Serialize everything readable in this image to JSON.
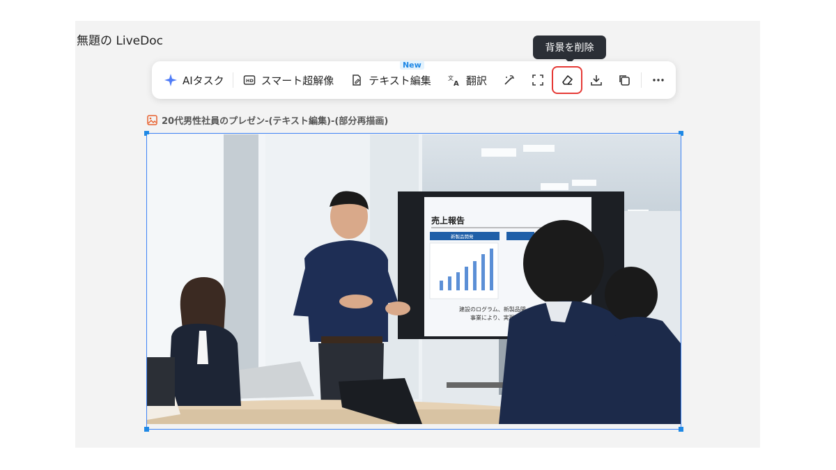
{
  "doc_title": "無題の LiveDoc",
  "tooltip": "背景を削除",
  "toolbar": {
    "ai_task": "AIタスク",
    "smart_upscale": "スマート超解像",
    "text_edit": "テキスト編集",
    "new_badge": "New",
    "translate": "翻訳"
  },
  "image_label": "20代男性社員のプレゼン-(テキスト編集)-(部分再描画)",
  "slide": {
    "title": "売上報告",
    "chart_header": "新製品開発",
    "caption_line1": "建設のログラム、新製品開",
    "caption_line2": "事業により、実現に変え"
  },
  "colors": {
    "accent": "#1e88e5",
    "active_border": "#e53935",
    "tooltip_bg": "#2b2f36"
  }
}
